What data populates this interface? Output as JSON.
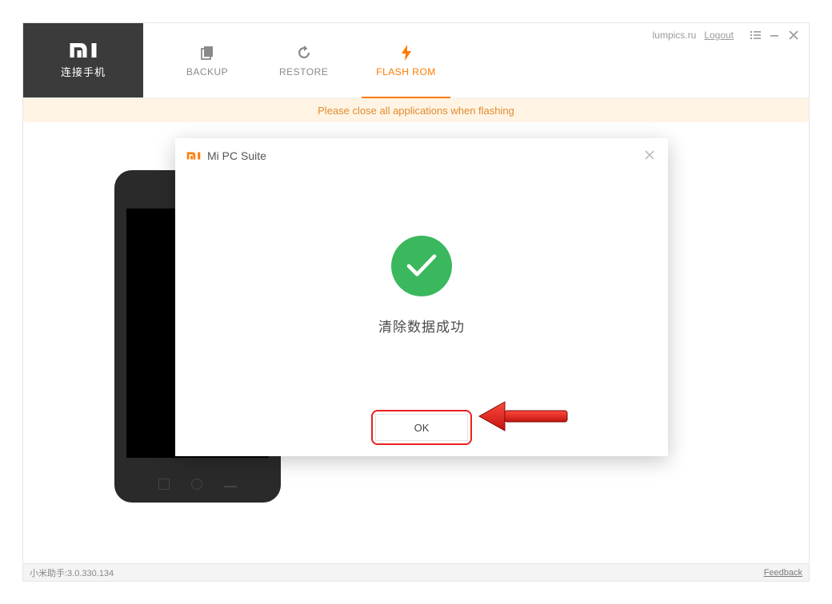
{
  "side_tile": {
    "label": "连接手机"
  },
  "tabs": {
    "backup": "BACKUP",
    "restore": "RESTORE",
    "flash": "FLASH ROM"
  },
  "top_right": {
    "site": "lumpics.ru",
    "logout": "Logout"
  },
  "warning": "Please close all applications when flashing",
  "modal": {
    "title": "Mi PC Suite",
    "message": "清除数据成功",
    "ok": "OK"
  },
  "footer": {
    "version": "小米助手:3.0.330.134",
    "feedback": "Feedback"
  }
}
